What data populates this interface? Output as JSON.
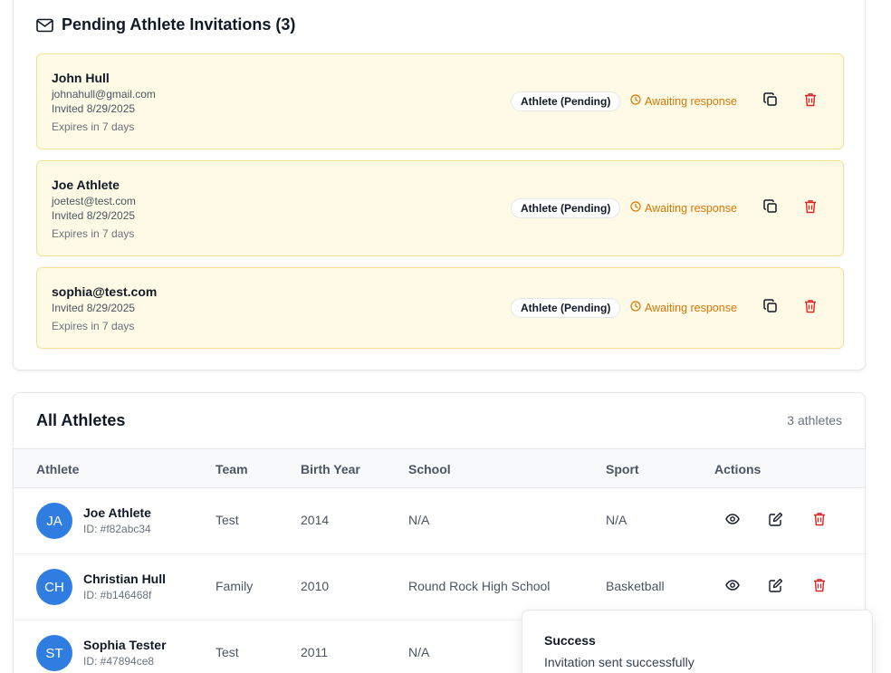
{
  "pending": {
    "title": "Pending Athlete Invitations (3)",
    "icon": "mail-icon",
    "invitations": [
      {
        "name": "John Hull",
        "email": "johnahull@gmail.com",
        "invited": "Invited 8/29/2025",
        "expires": "Expires in 7 days",
        "badge": "Athlete (Pending)",
        "status": "Awaiting response"
      },
      {
        "name": "Joe Athlete",
        "email": "joetest@test.com",
        "invited": "Invited 8/29/2025",
        "expires": "Expires in 7 days",
        "badge": "Athlete (Pending)",
        "status": "Awaiting response"
      },
      {
        "name": "sophia@test.com",
        "invited": "Invited 8/29/2025",
        "expires": "Expires in 7 days",
        "badge": "Athlete (Pending)",
        "status": "Awaiting response"
      }
    ]
  },
  "athletes": {
    "title": "All Athletes",
    "count": "3 athletes",
    "columns": [
      "Athlete",
      "Team",
      "Birth Year",
      "School",
      "Sport",
      "Actions"
    ],
    "rows": [
      {
        "initials": "JA",
        "name": "Joe Athlete",
        "id": "ID: #f82abc34",
        "team": "Test",
        "birth_year": "2014",
        "school": "N/A",
        "sport": "N/A"
      },
      {
        "initials": "CH",
        "name": "Christian Hull",
        "id": "ID: #b146468f",
        "team": "Family",
        "birth_year": "2010",
        "school": "Round Rock High School",
        "sport": "Basketball"
      },
      {
        "initials": "ST",
        "name": "Sophia Tester",
        "id": "ID: #47894ce8",
        "team": "Test",
        "birth_year": "2011",
        "school": "N/A",
        "sport": ""
      }
    ]
  },
  "toast": {
    "title": "Success",
    "message": "Invitation sent successfully"
  },
  "colors": {
    "pending_bg": "#fefae5",
    "pending_border": "#f6e08f",
    "awaiting": "#d97706",
    "delete": "#dc2626",
    "avatar": "#2f7de1"
  }
}
